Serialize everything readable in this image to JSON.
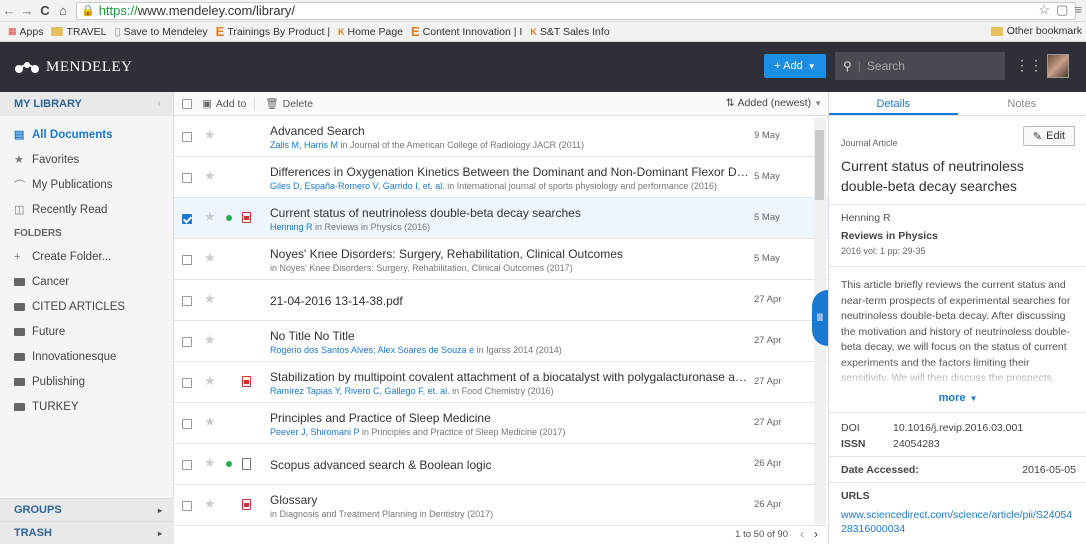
{
  "browser": {
    "url_https": "https://",
    "url_rest": "www.mendeley.com/library/",
    "bookmarks": [
      {
        "label": "Apps",
        "icon": "apps-grid-icon"
      },
      {
        "label": "TRAVEL",
        "icon": "folder-icon"
      },
      {
        "label": "Save to Mendeley",
        "icon": "page-icon"
      },
      {
        "label": "Trainings By Product |",
        "icon": "elsevier-e-icon"
      },
      {
        "label": "Home Page",
        "icon": "knovel-icon"
      },
      {
        "label": "Content Innovation | I",
        "icon": "elsevier-e-icon"
      },
      {
        "label": "S&T Sales Info",
        "icon": "knovel-icon"
      }
    ],
    "other_bookmarks": "Other bookmark"
  },
  "header": {
    "logo_text": "MENDELEY",
    "add_label": "+ Add",
    "search_placeholder": "Search"
  },
  "sidebar": {
    "my_library": "MY LIBRARY",
    "items": [
      {
        "label": "All Documents",
        "icon": "document-icon",
        "active": true
      },
      {
        "label": "Favorites",
        "icon": "star-icon"
      },
      {
        "label": "My Publications",
        "icon": "graduation-cap-icon"
      },
      {
        "label": "Recently Read",
        "icon": "open-book-icon"
      }
    ],
    "folders_label": "FOLDERS",
    "create_folder": "Create Folder...",
    "folders": [
      "Cancer",
      "CITED ARTICLES",
      "Future",
      "Innovationesque",
      "Publishing",
      "TURKEY"
    ],
    "groups": "GROUPS",
    "trash": "TRASH"
  },
  "toolbar": {
    "add_to": "Add to",
    "delete": "Delete",
    "sort": "Added (newest)"
  },
  "documents": [
    {
      "title": "Advanced Search",
      "authors": "Zalis M, Harris M",
      "source": "in Journal of the American College of Radiology JACR (2011)",
      "date": "9 May",
      "dot": false,
      "file": "none",
      "selected": false
    },
    {
      "title": "Differences in Oxygenation Kinetics Between the Dominant and Non-Dominant Flexor Digitor...",
      "authors": "Giles D, España-Romero V, Garrido I, et. al.",
      "source": "in International journal of sports physiology and performance (2016)",
      "date": "5 May",
      "dot": false,
      "file": "none",
      "selected": false
    },
    {
      "title": "Current status of neutrinoless double-beta decay searches",
      "authors": "Henning R",
      "source": "in Reviews in Physics (2016)",
      "date": "5 May",
      "dot": true,
      "file": "pdf",
      "selected": true
    },
    {
      "title": "Noyes' Knee Disorders: Surgery, Rehabilitation, Clinical Outcomes",
      "authors": "",
      "source": "in Noyes' Knee Disorders: Surgery, Rehabilitation, Clinical Outcomes (2017)",
      "date": "5 May",
      "dot": false,
      "file": "none",
      "selected": false
    },
    {
      "title": "21-04-2016 13-14-38.pdf",
      "authors": "",
      "source": "",
      "date": "27 Apr",
      "dot": false,
      "file": "none",
      "selected": false
    },
    {
      "title": "No Title No Title",
      "authors": "Rogério dos Santos Alves; Alex Soares de Souza e",
      "source": "in Igarss 2014 (2014)",
      "date": "27 Apr",
      "dot": false,
      "file": "none",
      "selected": false
    },
    {
      "title": "Stabilization by multipoint covalent attachment of a biocatalyst with polygalacturonase activit...",
      "authors": "Ramírez Tapias Y, Rivero C, Gallego F, et. al.",
      "source": "in Food Chemistry (2016)",
      "date": "27 Apr",
      "dot": false,
      "file": "pdf",
      "selected": false
    },
    {
      "title": "Principles and Practice of Sleep Medicine",
      "authors": "Peever J, Shiromani P",
      "source": "in Principles and Practice of Sleep Medicine (2017)",
      "date": "27 Apr",
      "dot": false,
      "file": "none",
      "selected": false
    },
    {
      "title": "Scopus advanced search & Boolean logic",
      "authors": "",
      "source": "",
      "date": "26 Apr",
      "dot": true,
      "file": "doc",
      "selected": false
    },
    {
      "title": "Glossary",
      "authors": "",
      "source": "in Diagnosis and Treatment Planning in Dentistry (2017)",
      "date": "26 Apr",
      "dot": false,
      "file": "pdf",
      "selected": false
    }
  ],
  "pager": {
    "text": "1 to 50 of 90"
  },
  "details": {
    "tab_details": "Details",
    "tab_notes": "Notes",
    "edit_label": "Edit",
    "type": "Journal Article",
    "title": "Current status of neutrinoless double-beta decay searches",
    "author": "Henning R",
    "journal": "Reviews in Physics",
    "meta": "2016 vol: 1 pp: 29-35",
    "abstract": "This article briefly reviews the current status and near-term prospects of experimental searches for neutrinoless double-beta decay. After discussing the motivation and history of neutrinoless double-beta decay, we will focus on the status of current experiments and the factors limiting their sensitivity. We will then discuss the prospects",
    "more": "more",
    "doi_label": "DOI",
    "doi": "10.1016/j.revip.2016.03.001",
    "issn_label": "ISSN",
    "issn": "24054283",
    "accessed_label": "Date Accessed:",
    "accessed": "2016-05-05",
    "urls_label": "URLS",
    "url": "www.sciencedirect.com/science/article/pii/S2405428316000034"
  }
}
